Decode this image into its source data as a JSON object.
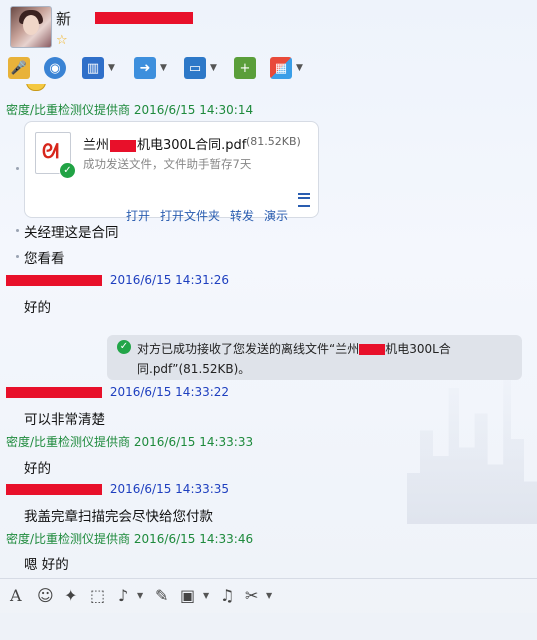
{
  "header": {
    "contact_name": "新",
    "star": "☆"
  },
  "toolbar": {
    "items": [
      {
        "icon": "microphone-icon"
      },
      {
        "icon": "video-call-icon"
      },
      {
        "icon": "remote-assist-icon"
      },
      {
        "icon": "send-file-icon"
      },
      {
        "icon": "screen-share-icon"
      },
      {
        "icon": "create-group-icon"
      },
      {
        "icon": "app-grid-icon"
      }
    ]
  },
  "messages": [
    {
      "sender": "密度/比重检测仪提供商",
      "time": "2016/6/15 14:30:14"
    },
    {
      "time": "2016/6/15 14:31:26",
      "text": "好的"
    },
    {
      "time": "2016/6/15 14:33:22",
      "text": "可以非常清楚"
    },
    {
      "sender": "密度/比重检测仪提供商",
      "time": "2016/6/15 14:33:33",
      "text": "好的"
    },
    {
      "time": "2016/6/15 14:33:35",
      "text": "我盖完章扫描完会尽快给您付款"
    },
    {
      "sender": "密度/比重检测仪提供商",
      "time": "2016/6/15 14:33:46",
      "text": "嗯 好的"
    }
  ],
  "file_card": {
    "name_prefix": "兰州",
    "name_suffix": "机电300L合同.pdf",
    "size": "(81.52KB)",
    "status": "成功发送文件，文件助手暂存7天",
    "actions": [
      "打开",
      "打开文件夹",
      "转发",
      "演示"
    ]
  },
  "followups": [
    "关经理这是合同",
    "您看看"
  ],
  "notice": {
    "line1_prefix": "对方已成功接收了您发送的离线文件“兰州",
    "line1_suffix": "机电300L合",
    "line2": "同.pdf”(81.52KB)。"
  },
  "input_toolbar": {
    "items": [
      "font-icon",
      "emoji-icon",
      "magic-icon",
      "screenshot-icon",
      "voice-icon",
      "edit-icon",
      "image-icon",
      "music-icon",
      "cut-icon"
    ]
  }
}
